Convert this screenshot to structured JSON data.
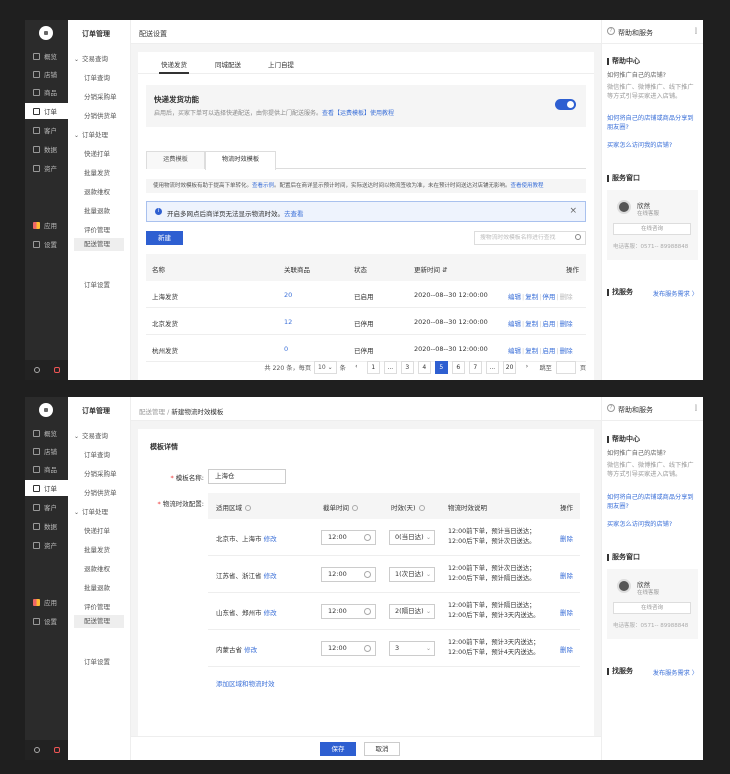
{
  "nav": {
    "items": [
      "概览",
      "店铺",
      "商品",
      "订单",
      "客户",
      "数据",
      "资产",
      "应用",
      "设置"
    ],
    "icons": [
      "monitor-icon",
      "store-icon",
      "tag-icon",
      "order-icon",
      "user-icon",
      "chart-icon",
      "wallet-icon",
      "apps-icon",
      "gear-icon"
    ]
  },
  "sub": {
    "title": "订单管理",
    "groups": [
      {
        "title": "交易查询",
        "items": [
          "订单查询",
          "分销采购单",
          "分销供货单"
        ]
      },
      {
        "title": "订单处理",
        "items": [
          "快递打单",
          "批量发货",
          "退款维权",
          "批量退款",
          "评价管理",
          "配送管理"
        ]
      }
    ],
    "footer": "订单设置"
  },
  "right": {
    "header": "帮助和服务",
    "help_title": "帮助中心",
    "help_q": "如何推广自己的店铺?",
    "help_a": "微信推广、微博推广、线下推广等方式引导买家进入店铺。",
    "help_links": [
      "如何将自己的店铺或商品分享到朋友圈?",
      "买家怎么访问我的店铺?"
    ],
    "service_title": "服务窗口",
    "service_name": "欣然",
    "service_status": "在线客服",
    "service_btn": "在线咨询",
    "service_phone": "电话客服：0571-- 89988848",
    "find_title": "找服务",
    "find_link": "发布服务需求 〉"
  },
  "page1": {
    "top_title": "配送设置",
    "tabs": [
      "快递发货",
      "同城配送",
      "上门自提"
    ],
    "feature_title": "快递发货功能",
    "feature_desc": "启用后，买家下单可以选择快递配送，由你提供上门配送服务。",
    "feature_link": "查看【运费模板】使用教程",
    "card_tabs": [
      "运费模板",
      "物流时效模板"
    ],
    "tip_text": "使用物流时效模板有助于提高下单转化。",
    "tip_link1": "查看示例",
    "tip_text2": "。配置后在商详显示预计时间，实际送达时间以物流签收为准，未在预计时间送达对店铺无影响。",
    "tip_link2": "查看使用教程",
    "info_text": "开启多网点后商详页无法显示物流时效。",
    "info_link": "去查看",
    "new_btn": "新建",
    "search_placeholder": "搜物流时效模板名称进行查找",
    "columns": [
      "名称",
      "关联商品",
      "状态",
      "更新时间 ⇵",
      "操作"
    ],
    "rows": [
      {
        "name": "上海发货",
        "count": "20",
        "status": "已启用",
        "time": "2020--08--30 12:00:00",
        "ops": [
          "编辑",
          "复制",
          "停用",
          "删除"
        ]
      },
      {
        "name": "北京发货",
        "count": "12",
        "status": "已停用",
        "time": "2020--08--30 12:00:00",
        "ops": [
          "编辑",
          "复制",
          "启用",
          "删除"
        ]
      },
      {
        "name": "杭州发货",
        "count": "0",
        "status": "已停用",
        "time": "2020--08--30 12:00:00",
        "ops": [
          "编辑",
          "复制",
          "启用",
          "删除"
        ]
      }
    ],
    "pager": {
      "total": "共 220 条，每页",
      "size": "10",
      "unit": "条",
      "pages": [
        "‹",
        "1",
        "...",
        "3",
        "4",
        "5",
        "6",
        "7",
        "...",
        "20",
        "›"
      ],
      "current": "5",
      "jump": "跳至",
      "page_unit": "页"
    }
  },
  "page2": {
    "crumb_parent": "配送管理",
    "crumb_sep": "/",
    "crumb_current": "新建物流时效模板",
    "section": "模板详情",
    "name_label": "模板名称:",
    "name_value": "上海仓",
    "rule_label": "物流时效配置:",
    "columns": [
      "适用区域",
      "截单时间",
      "时效(天)",
      "物流时效说明",
      "操作"
    ],
    "rows": [
      {
        "area": "北京市、上海市",
        "edit": "修改",
        "cutoff": "12:00",
        "days": "0(当日达)",
        "desc1": "12:00前下单，预计当日送达；",
        "desc2": "12:00后下单，预计次日送达。",
        "op": "删除"
      },
      {
        "area": "江苏省、浙江省",
        "edit": "修改",
        "cutoff": "12:00",
        "days": "1(次日达)",
        "desc1": "12:00前下单，预计次日送达；",
        "desc2": "12:00后下单，预计隔日送达。",
        "op": "删除"
      },
      {
        "area": "山东省、郑州市",
        "edit": "修改",
        "cutoff": "12:00",
        "days": "2(隔日达)",
        "desc1": "12:00前下单，预计隔日送达；",
        "desc2": "12:00后下单，预计3天内送达。",
        "op": "删除"
      },
      {
        "area": "内蒙古省",
        "edit": "修改",
        "cutoff": "12:00",
        "days": "3",
        "desc1": "12:00前下单，预计3天内送达；",
        "desc2": "12:00后下单，预计4天内送达。",
        "op": "删除"
      }
    ],
    "add_link": "添加区域和物流时效",
    "save": "保存",
    "cancel": "取消"
  }
}
